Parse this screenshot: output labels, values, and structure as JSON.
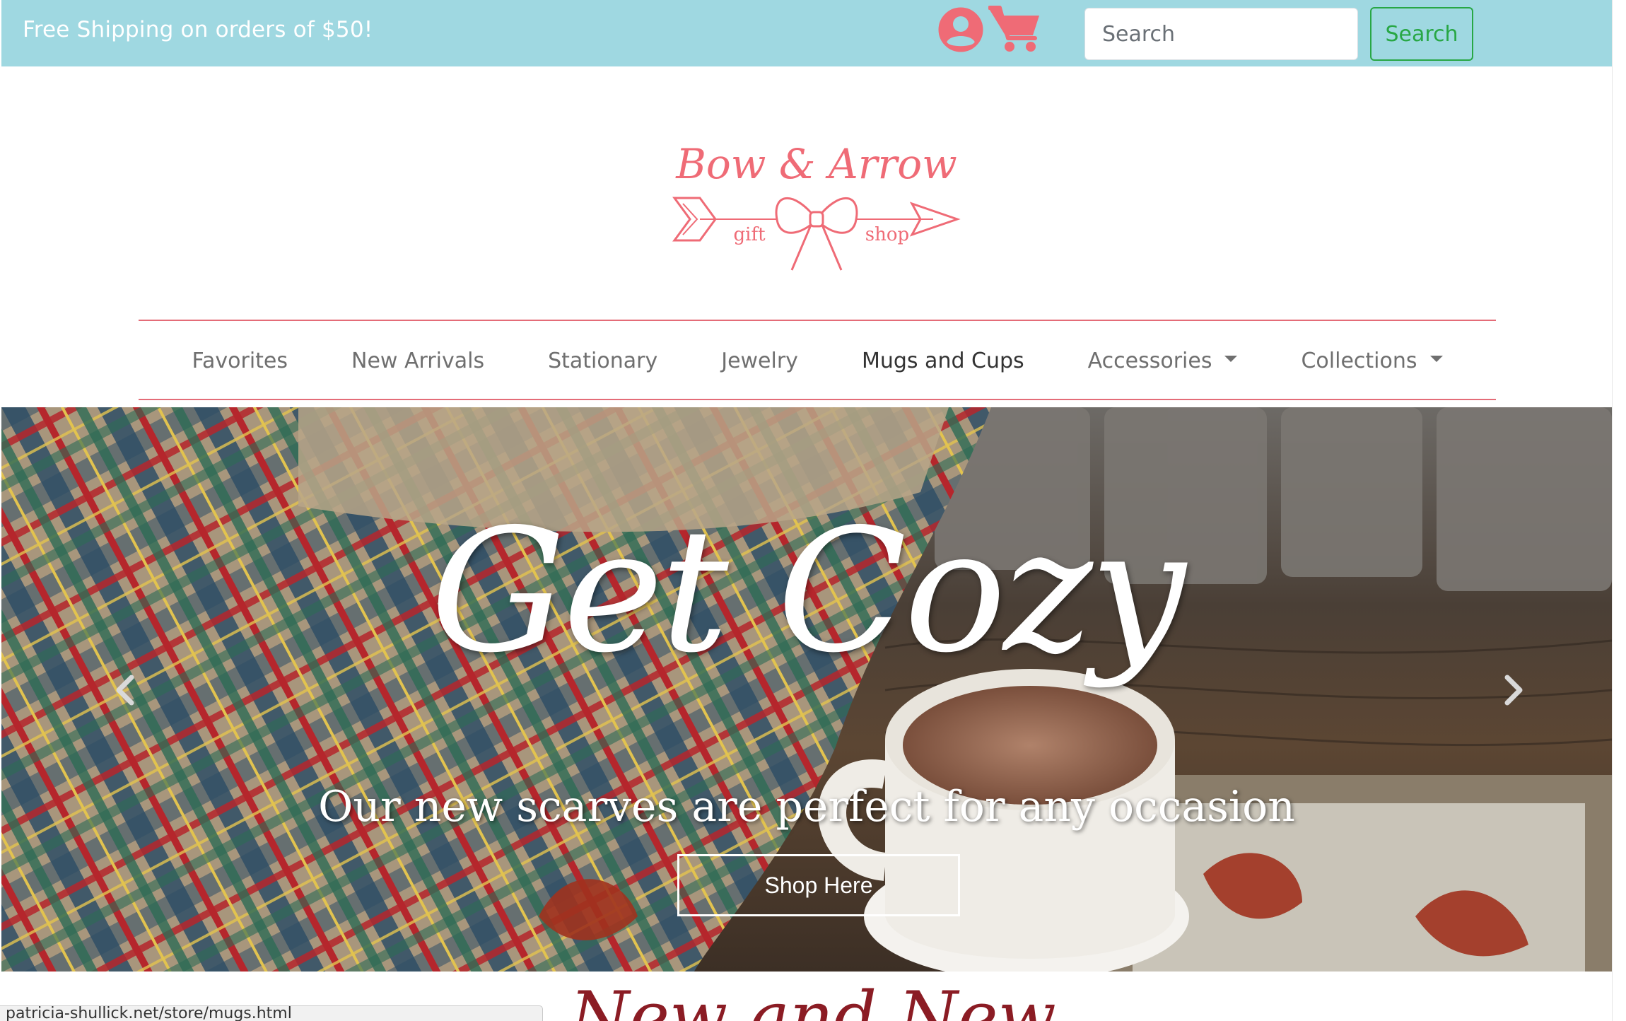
{
  "topbar": {
    "promo": "Free Shipping on orders of $50!",
    "user_icon": "user-circle-icon",
    "cart_icon": "shopping-cart-icon",
    "search_placeholder": "Search",
    "search_button": "Search"
  },
  "logo": {
    "text_main": "Bow & Arrow",
    "text_left": "gift",
    "text_right": "shop"
  },
  "nav": {
    "items": [
      {
        "label": "Favorites"
      },
      {
        "label": "New Arrivals"
      },
      {
        "label": "Stationary"
      },
      {
        "label": "Jewelry"
      },
      {
        "label": "Mugs and Cups"
      },
      {
        "label": "Accessories"
      },
      {
        "label": "Collections"
      }
    ]
  },
  "hero": {
    "title": "Get Cozy",
    "subtitle": "Our new scarves are perfect for any occasion",
    "button": "Shop Here",
    "prev_icon": "chevron-left-icon",
    "next_icon": "chevron-right-icon"
  },
  "section": {
    "heading": "New and New"
  },
  "status_bar": {
    "url": "patricia-shullick.net/store/mugs.html"
  },
  "colors": {
    "topbar_bg": "#9fd8e1",
    "accent_pink": "#ef6b76",
    "search_green": "#28a745",
    "heading_red": "#8b1c24"
  }
}
